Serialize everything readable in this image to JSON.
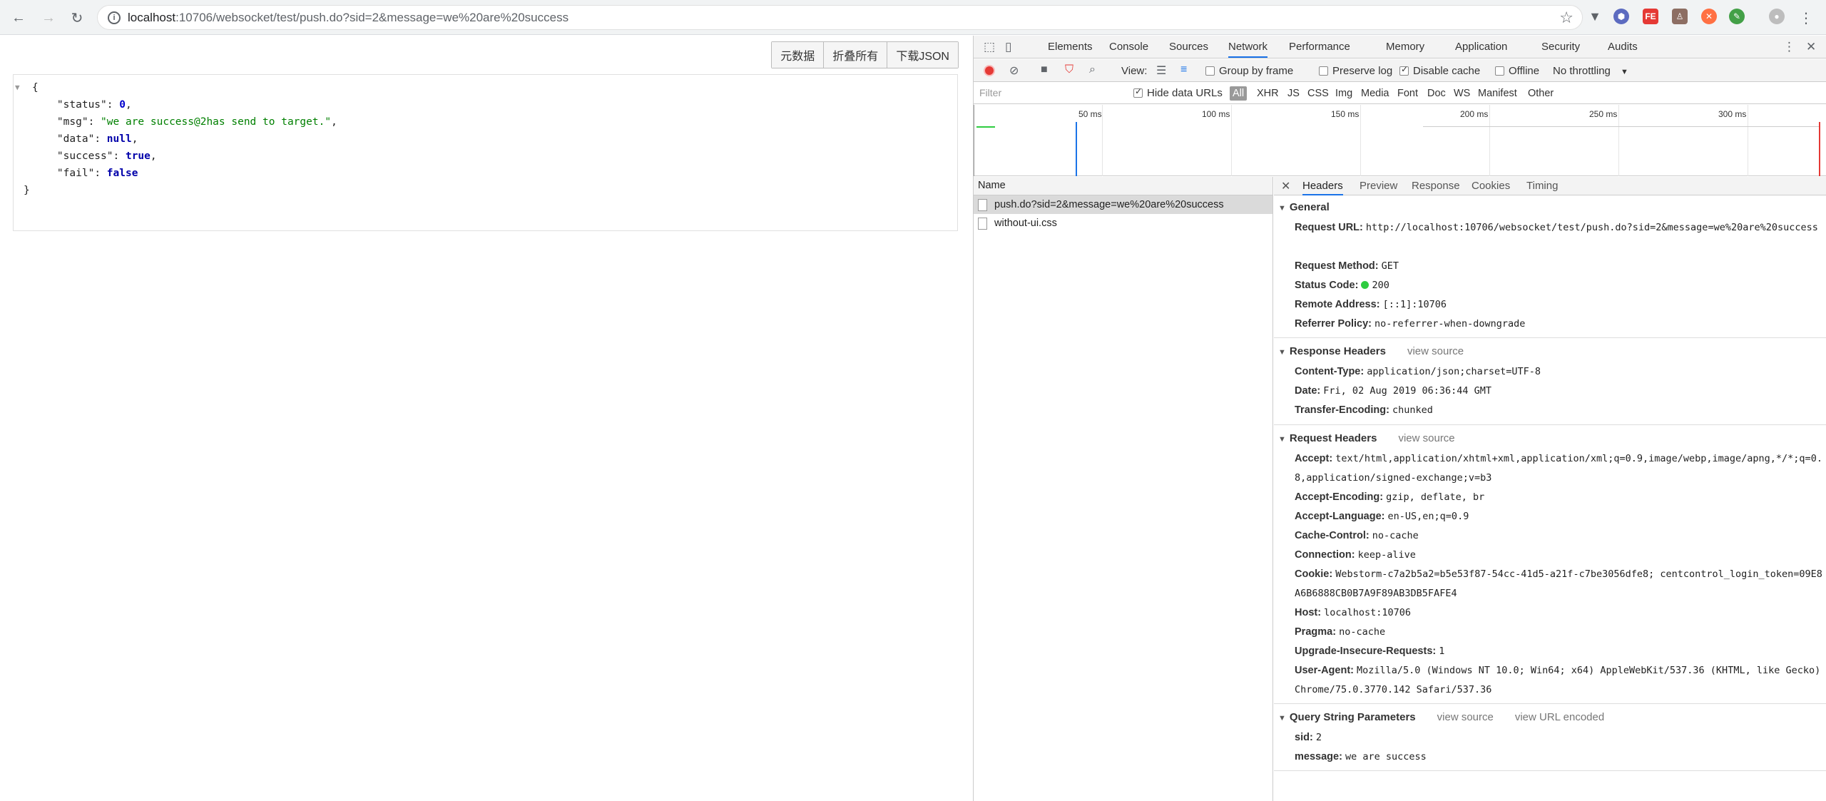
{
  "browser": {
    "url_host": "localhost",
    "url_path": ":10706/websocket/test/push.do?sid=2&message=we%20are%20success"
  },
  "toolbar": {
    "raw_label": "元数据",
    "collapse_label": "折叠所有",
    "download_label": "下载JSON"
  },
  "json": {
    "status_key": "\"status\"",
    "status_val": "0",
    "msg_key": "\"msg\"",
    "msg_val": "\"we are success@2has send to target.\"",
    "data_key": "\"data\"",
    "data_val": "null",
    "success_key": "\"success\"",
    "success_val": "true",
    "fail_key": "\"fail\"",
    "fail_val": "false"
  },
  "devtools": {
    "tabs": [
      "Elements",
      "Console",
      "Sources",
      "Network",
      "Performance",
      "Memory",
      "Application",
      "Security",
      "Audits"
    ],
    "active_tab": "Network",
    "view_label": "View:",
    "group_by_frame": "Group by frame",
    "preserve_log": "Preserve log",
    "disable_cache": "Disable cache",
    "offline": "Offline",
    "throttling": "No throttling",
    "filter_placeholder": "Filter",
    "hide_data_urls": "Hide data URLs",
    "types": [
      "All",
      "XHR",
      "JS",
      "CSS",
      "Img",
      "Media",
      "Font",
      "Doc",
      "WS",
      "Manifest",
      "Other"
    ],
    "ticks": [
      "50 ms",
      "100 ms",
      "150 ms",
      "200 ms",
      "250 ms",
      "300 ms"
    ],
    "name_header": "Name",
    "requests": [
      "push.do?sid=2&message=we%20are%20success",
      "without-ui.css"
    ],
    "detail_tabs": [
      "Headers",
      "Preview",
      "Response",
      "Cookies",
      "Timing"
    ],
    "general": {
      "title": "General",
      "request_url_k": "Request URL:",
      "request_url_v": "http://localhost:10706/websocket/test/push.do?sid=2&message=we%20are%20success",
      "method_k": "Request Method:",
      "method_v": "GET",
      "status_k": "Status Code:",
      "status_v": "200",
      "remote_k": "Remote Address:",
      "remote_v": "[::1]:10706",
      "referrer_k": "Referrer Policy:",
      "referrer_v": "no-referrer-when-downgrade"
    },
    "response_headers": {
      "title": "Response Headers",
      "view_source": "view source",
      "ct_k": "Content-Type:",
      "ct_v": "application/json;charset=UTF-8",
      "date_k": "Date:",
      "date_v": "Fri, 02 Aug 2019 06:36:44 GMT",
      "te_k": "Transfer-Encoding:",
      "te_v": "chunked"
    },
    "request_headers": {
      "title": "Request Headers",
      "view_source": "view source",
      "accept_k": "Accept:",
      "accept_v": "text/html,application/xhtml+xml,application/xml;q=0.9,image/webp,image/apng,*/*;q=0.8,application/signed-exchange;v=b3",
      "ae_k": "Accept-Encoding:",
      "ae_v": "gzip, deflate, br",
      "al_k": "Accept-Language:",
      "al_v": "en-US,en;q=0.9",
      "cc_k": "Cache-Control:",
      "cc_v": "no-cache",
      "conn_k": "Connection:",
      "conn_v": "keep-alive",
      "cookie_k": "Cookie:",
      "cookie_v": "Webstorm-c7a2b5a2=b5e53f87-54cc-41d5-a21f-c7be3056dfe8; centcontrol_login_token=09E8A6B6888CB0B7A9F89AB3DB5FAFE4",
      "host_k": "Host:",
      "host_v": "localhost:10706",
      "pragma_k": "Pragma:",
      "pragma_v": "no-cache",
      "uir_k": "Upgrade-Insecure-Requests:",
      "uir_v": "1",
      "ua_k": "User-Agent:",
      "ua_v": "Mozilla/5.0 (Windows NT 10.0; Win64; x64) AppleWebKit/537.36 (KHTML, like Gecko) Chrome/75.0.3770.142 Safari/537.36"
    },
    "query": {
      "title": "Query String Parameters",
      "view_source": "view source",
      "view_url_encoded": "view URL encoded",
      "sid_k": "sid:",
      "sid_v": "2",
      "msg_k": "message:",
      "msg_v": "we are success"
    }
  }
}
